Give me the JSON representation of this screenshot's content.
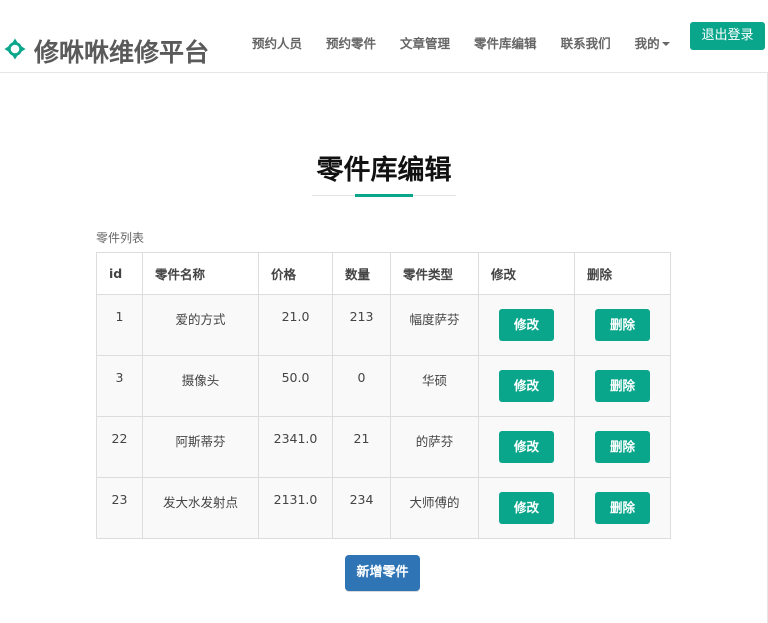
{
  "brand": {
    "name": "修咻咻维修平台",
    "icon": "crosshair-icon",
    "color": "#0aa68b"
  },
  "nav": {
    "items": [
      "预约人员",
      "预约零件",
      "文章管理",
      "零件库编辑",
      "联系我们",
      "我的"
    ],
    "logout_label": "退出登录"
  },
  "page": {
    "title": "零件库编辑",
    "table_caption": "零件列表"
  },
  "table": {
    "headers": [
      "id",
      "零件名称",
      "价格",
      "数量",
      "零件类型",
      "修改",
      "删除"
    ],
    "rows": [
      {
        "id": "1",
        "name": "爱的方式",
        "price": "21.0",
        "qty": "213",
        "type": "幅度萨芬",
        "edit": "修改",
        "delete": "删除"
      },
      {
        "id": "3",
        "name": "摄像头",
        "price": "50.0",
        "qty": "0",
        "type": "华硕",
        "edit": "修改",
        "delete": "删除"
      },
      {
        "id": "22",
        "name": "阿斯蒂芬",
        "price": "2341.0",
        "qty": "21",
        "type": "的萨芬",
        "edit": "修改",
        "delete": "删除"
      },
      {
        "id": "23",
        "name": "发大水发射点",
        "price": "2131.0",
        "qty": "234",
        "type": "大师傅的",
        "edit": "修改",
        "delete": "删除"
      }
    ]
  },
  "actions": {
    "add_label": "新增零件"
  },
  "colors": {
    "accent": "#0aa68b",
    "primary": "#2f74b5"
  }
}
